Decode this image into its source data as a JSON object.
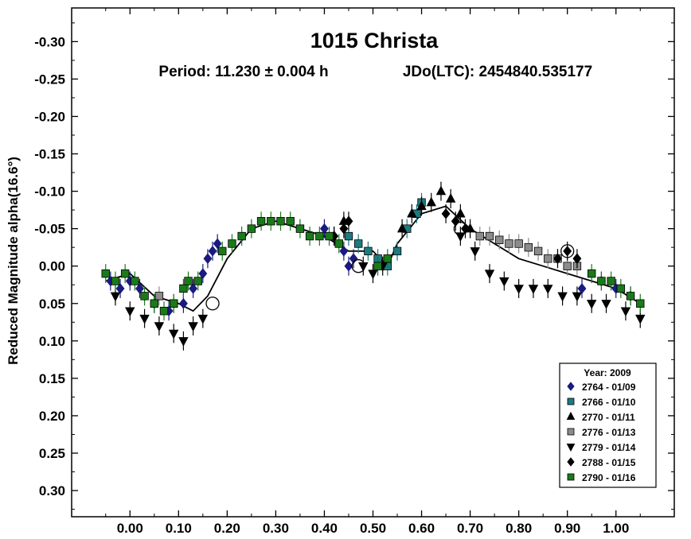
{
  "chart_data": {
    "type": "scatter",
    "title": "1015 Christa",
    "subtitle_period": "Period: 11.230 ± 0.004 h",
    "subtitle_epoch": "JDo(LTC): 2454840.535177",
    "xlabel": "",
    "ylabel": "Reduced Magnitude alpha(16.6°)",
    "xlim": [
      -0.12,
      1.12
    ],
    "ylim": [
      -0.345,
      0.335
    ],
    "y_reversed": true,
    "x_ticks": [
      "0.00",
      "0.10",
      "0.20",
      "0.30",
      "0.40",
      "0.50",
      "0.60",
      "0.70",
      "0.80",
      "0.90",
      "1.00"
    ],
    "x_tick_values": [
      0,
      0.1,
      0.2,
      0.3,
      0.4,
      0.5,
      0.6,
      0.7,
      0.8,
      0.9,
      1.0
    ],
    "y_ticks": [
      "-0.30",
      "-0.25",
      "-0.20",
      "-0.15",
      "-0.10",
      "-0.05",
      "0.00",
      "0.05",
      "0.10",
      "0.15",
      "0.20",
      "0.25",
      "0.30"
    ],
    "y_tick_values": [
      -0.3,
      -0.25,
      -0.2,
      -0.15,
      -0.1,
      -0.05,
      0.0,
      0.05,
      0.1,
      0.15,
      0.2,
      0.25,
      0.3
    ],
    "grid": false,
    "legend": {
      "placement": "bottom-right",
      "title": "Year: 2009",
      "entries": [
        {
          "label": "2764 - 01/09",
          "marker": "diamond",
          "color": "#1a1a80"
        },
        {
          "label": "2766 - 01/10",
          "marker": "square",
          "color": "#1e7b80"
        },
        {
          "label": "2770 - 01/11",
          "marker": "triangle-up",
          "color": "#000000"
        },
        {
          "label": "2776 - 01/13",
          "marker": "square",
          "color": "#8c8c8c"
        },
        {
          "label": "2779 - 01/14",
          "marker": "triangle-down",
          "color": "#000000"
        },
        {
          "label": "2788 - 01/15",
          "marker": "diamond",
          "color": "#000000"
        },
        {
          "label": "2790 - 01/16",
          "marker": "square",
          "color": "#1a7a1a"
        }
      ]
    },
    "fit_curve": {
      "x": [
        -0.05,
        0.0,
        0.05,
        0.1,
        0.13,
        0.16,
        0.2,
        0.25,
        0.3,
        0.35,
        0.4,
        0.45,
        0.5,
        0.53,
        0.55,
        0.6,
        0.65,
        0.7,
        0.75,
        0.8,
        0.85,
        0.9,
        0.95,
        1.0,
        1.05
      ],
      "y": [
        0.02,
        0.01,
        0.04,
        0.05,
        0.06,
        0.04,
        -0.01,
        -0.05,
        -0.06,
        -0.05,
        -0.04,
        -0.02,
        -0.02,
        0.0,
        -0.03,
        -0.07,
        -0.08,
        -0.05,
        -0.03,
        -0.01,
        0.0,
        0.01,
        0.02,
        0.03,
        0.05
      ],
      "color": "#000000"
    },
    "series": [
      {
        "name": "2764 - 01/09",
        "marker": "diamond",
        "color": "#1a1a80",
        "x": [
          -0.04,
          -0.02,
          0.0,
          0.02,
          0.05,
          0.08,
          0.11,
          0.13,
          0.15,
          0.16,
          0.17,
          0.18,
          0.4,
          0.42,
          0.44,
          0.45,
          0.46,
          0.93,
          0.97,
          1.0,
          1.03
        ],
        "y": [
          0.02,
          0.03,
          0.02,
          0.03,
          0.05,
          0.06,
          0.05,
          0.03,
          0.01,
          -0.01,
          -0.02,
          -0.03,
          -0.05,
          -0.04,
          -0.02,
          0.0,
          -0.01,
          0.03,
          0.02,
          0.03,
          0.04
        ]
      },
      {
        "name": "2766 - 01/10",
        "marker": "square",
        "color": "#1e7b80",
        "x": [
          0.45,
          0.47,
          0.49,
          0.51,
          0.53,
          0.55,
          0.57,
          0.59,
          0.6
        ],
        "y": [
          -0.04,
          -0.03,
          -0.02,
          -0.01,
          0.0,
          -0.02,
          -0.05,
          -0.07,
          -0.085
        ]
      },
      {
        "name": "2770 - 01/11",
        "marker": "triangle-up",
        "color": "#000000",
        "x": [
          0.56,
          0.58,
          0.6,
          0.62,
          0.64,
          0.66,
          0.68,
          0.7,
          0.44
        ],
        "y": [
          -0.05,
          -0.07,
          -0.08,
          -0.085,
          -0.1,
          -0.09,
          -0.07,
          -0.05,
          -0.06
        ]
      },
      {
        "name": "2776 - 01/13",
        "marker": "square",
        "color": "#8c8c8c",
        "x": [
          0.06,
          0.09,
          0.72,
          0.74,
          0.76,
          0.78,
          0.8,
          0.82,
          0.84,
          0.86,
          0.88,
          0.9,
          0.92
        ],
        "y": [
          0.04,
          0.05,
          -0.04,
          -0.04,
          -0.035,
          -0.03,
          -0.03,
          -0.025,
          -0.02,
          -0.01,
          -0.01,
          0.0,
          0.0
        ]
      },
      {
        "name": "2779 - 01/14",
        "marker": "triangle-down",
        "color": "#000000",
        "x": [
          -0.03,
          0.0,
          0.03,
          0.06,
          0.09,
          0.11,
          0.13,
          0.15,
          0.48,
          0.5,
          0.52,
          0.68,
          0.71,
          0.74,
          0.77,
          0.8,
          0.83,
          0.86,
          0.89,
          0.92,
          0.95,
          0.98,
          1.02,
          1.05
        ],
        "y": [
          0.04,
          0.06,
          0.07,
          0.08,
          0.09,
          0.1,
          0.08,
          0.07,
          0.0,
          0.01,
          0.0,
          -0.04,
          -0.02,
          0.01,
          0.02,
          0.03,
          0.03,
          0.03,
          0.04,
          0.04,
          0.05,
          0.05,
          0.06,
          0.07
        ]
      },
      {
        "name": "2788 - 01/15",
        "marker": "diamond",
        "color": "#000000",
        "x": [
          0.42,
          0.44,
          0.45,
          0.65,
          0.67,
          0.69,
          0.88,
          0.9,
          0.92
        ],
        "y": [
          -0.04,
          -0.05,
          -0.06,
          -0.07,
          -0.06,
          -0.05,
          -0.01,
          -0.02,
          -0.01
        ],
        "hollow_x": [
          0.17,
          0.47,
          0.68,
          0.9
        ],
        "hollow_y": [
          0.05,
          0.0,
          -0.05,
          -0.02
        ]
      },
      {
        "name": "2790 - 01/16",
        "marker": "square",
        "color": "#1a7a1a",
        "x": [
          -0.05,
          -0.03,
          -0.01,
          0.01,
          0.03,
          0.05,
          0.07,
          0.09,
          0.11,
          0.12,
          0.14,
          0.19,
          0.21,
          0.23,
          0.25,
          0.27,
          0.29,
          0.31,
          0.33,
          0.35,
          0.37,
          0.39,
          0.41,
          0.43,
          0.51,
          0.53,
          0.95,
          0.97,
          0.99,
          1.01,
          1.03,
          1.05
        ],
        "y": [
          0.01,
          0.02,
          0.01,
          0.02,
          0.04,
          0.05,
          0.06,
          0.05,
          0.03,
          0.02,
          0.02,
          -0.02,
          -0.03,
          -0.04,
          -0.05,
          -0.06,
          -0.06,
          -0.06,
          -0.06,
          -0.05,
          -0.04,
          -0.04,
          -0.04,
          -0.03,
          0.0,
          -0.01,
          0.01,
          0.02,
          0.02,
          0.03,
          0.04,
          0.05
        ]
      }
    ]
  }
}
